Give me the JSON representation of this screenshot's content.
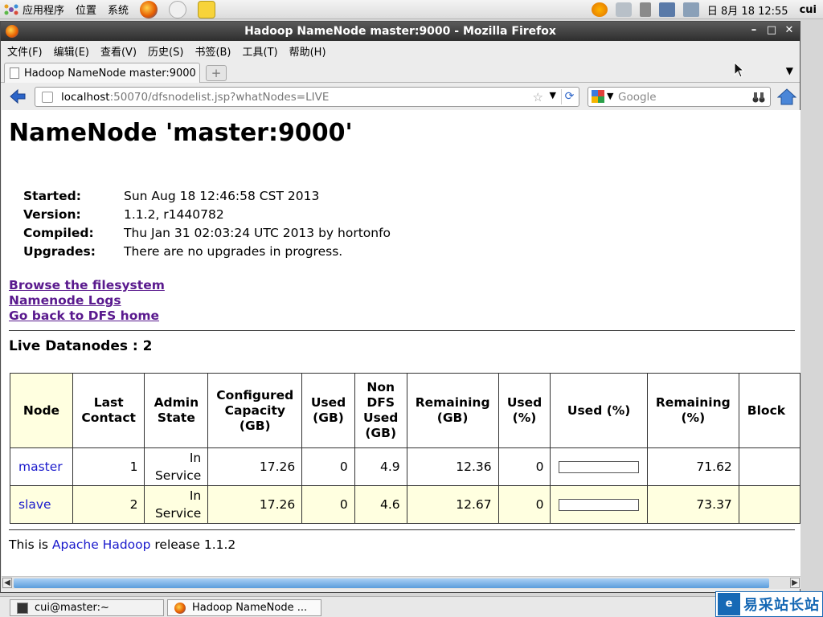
{
  "top_panel": {
    "menu": {
      "apps": "应用程序",
      "places": "位置",
      "system": "系统"
    },
    "clock": "日 8月 18 12:55",
    "user": "cui"
  },
  "window": {
    "title": "Hadoop NameNode master:9000 - Mozilla Firefox",
    "menubar": [
      "文件(F)",
      "编辑(E)",
      "查看(V)",
      "历史(S)",
      "书签(B)",
      "工具(T)",
      "帮助(H)"
    ],
    "tab_title": "Hadoop NameNode master:9000",
    "new_tab": "+",
    "url_host": "localhost",
    "url_rest": ":50070/dfsnodelist.jsp?whatNodes=LIVE",
    "search_placeholder": "Google"
  },
  "page": {
    "heading": "NameNode 'master:9000'",
    "info": [
      {
        "label": "Started:",
        "value": "Sun Aug 18 12:46:58 CST 2013"
      },
      {
        "label": "Version:",
        "value": "1.1.2, r1440782"
      },
      {
        "label": "Compiled:",
        "value": "Thu Jan 31 02:03:24 UTC 2013 by hortonfo"
      },
      {
        "label": "Upgrades:",
        "value": "There are no upgrades in progress."
      }
    ],
    "links": [
      "Browse the filesystem",
      "Namenode Logs",
      "Go back to DFS home"
    ],
    "live_title": "Live Datanodes : 2",
    "columns": [
      "Node",
      "Last Contact",
      "Admin State",
      "Configured Capacity (GB)",
      "Used (GB)",
      "Non DFS Used (GB)",
      "Remaining (GB)",
      "Used (%)",
      "Used (%)",
      "Remaining (%)",
      "Block"
    ],
    "rows": [
      {
        "node": "master",
        "last_contact": "1",
        "admin_state": "In Service",
        "capacity": "17.26",
        "used": "0",
        "non_dfs": "4.9",
        "remaining": "12.36",
        "used_pct": "0",
        "used_bar": 0,
        "remaining_pct": "71.62"
      },
      {
        "node": "slave",
        "last_contact": "2",
        "admin_state": "In Service",
        "capacity": "17.26",
        "used": "0",
        "non_dfs": "4.6",
        "remaining": "12.67",
        "used_pct": "0",
        "used_bar": 0,
        "remaining_pct": "73.37"
      }
    ],
    "footer_prefix": "This is ",
    "footer_link": "Apache Hadoop",
    "footer_suffix": " release 1.1.2"
  },
  "taskbar": {
    "items": [
      "cui@master:~",
      "Hadoop NameNode ..."
    ]
  },
  "brand_text": "易采站长站",
  "colors": {
    "link_visited": "#5a1a8e",
    "link": "#1a1acc",
    "row_alt": "#ffffe0"
  }
}
